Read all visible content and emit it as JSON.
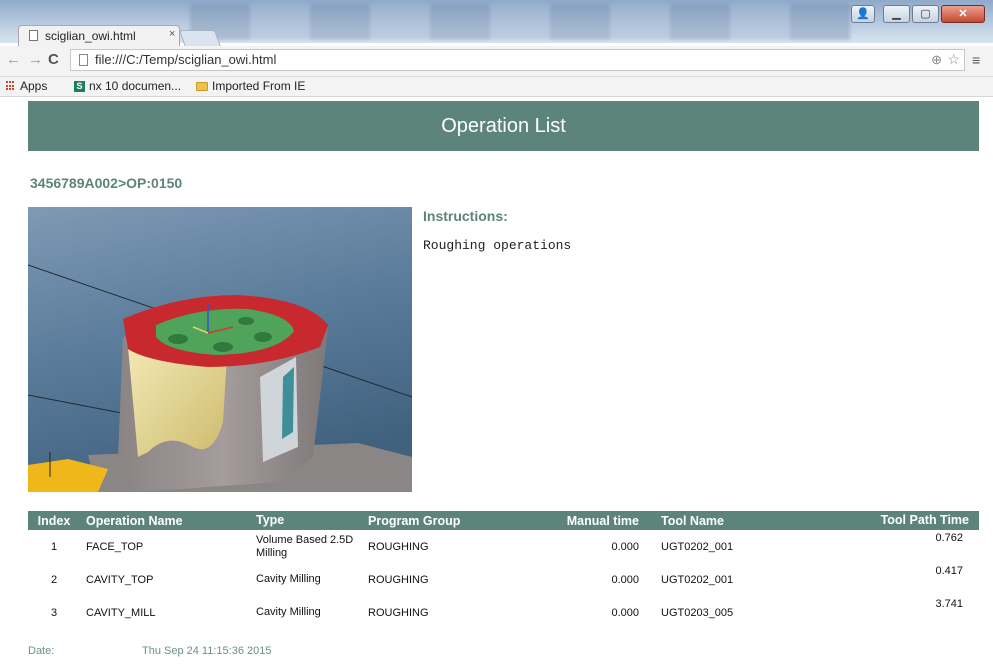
{
  "browser": {
    "tab_title": "sciglian_owi.html",
    "tab_close": "×",
    "url": "file:///C:/Temp/sciglian_owi.html",
    "bookmarks": [
      {
        "label": "Apps",
        "icon": "apps-grid-icon"
      },
      {
        "label": "nx 10 documen...",
        "icon": "nx-doc-icon"
      },
      {
        "label": "Imported From IE",
        "icon": "folder-icon"
      }
    ]
  },
  "page": {
    "header": "Operation List",
    "operation_path": "3456789A002>OP:0150",
    "instructions_label": "Instructions:",
    "instructions_text": "Roughing operations",
    "table": {
      "headers": [
        "Index",
        "Operation Name",
        "Type",
        "Program Group",
        "Manual time",
        "Tool Name",
        "Tool Path Time"
      ],
      "rows": [
        [
          "1",
          "FACE_TOP",
          "Volume Based 2.5D Milling",
          "ROUGHING",
          "0.000",
          "UGT0202_001",
          "0.762"
        ],
        [
          "2",
          "CAVITY_TOP",
          "Cavity Milling",
          "ROUGHING",
          "0.000",
          "UGT0202_001",
          "0.417"
        ],
        [
          "3",
          "CAVITY_MILL",
          "Cavity Milling",
          "ROUGHING",
          "0.000",
          "UGT0203_005",
          "3.741"
        ]
      ]
    },
    "date_label": "Date:",
    "date_value": "Thu Sep 24 11:15:36 2015"
  },
  "colors": {
    "accent": "#5c847b",
    "cad_background": "#5a7a99",
    "part_red": "#c8292e",
    "part_green": "#4fa35a",
    "part_gold": "#e8d99a"
  }
}
